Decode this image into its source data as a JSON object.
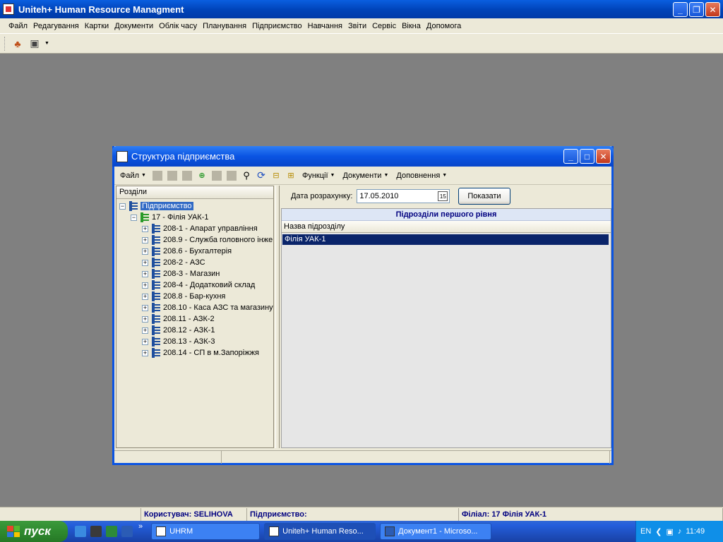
{
  "app": {
    "title": "Uniteh+ Human Resource Managment",
    "menu": [
      "Файл",
      "Редагування",
      "Картки",
      "Документи",
      "Облік часу",
      "Планування",
      "Підприємство",
      "Навчання",
      "Звіти",
      "Сервіс",
      "Вікна",
      "Допомога"
    ]
  },
  "child": {
    "title": "Структура підприємства",
    "toolbar": {
      "file": "Файл",
      "functions": "Функції",
      "documents": "Документи",
      "additions": "Доповнення"
    },
    "left_header": "Розділи",
    "tree": {
      "root": "Підприємство",
      "branch": "17 - Філія УАК-1",
      "children": [
        "208-1 - Апарат управління",
        "208.9 - Служба головного інже",
        "208.6 - Бухгалтерія",
        "208-2 - АЗС",
        "208-3 - Магазин",
        "208-4 - Додатковий склад",
        "208.8 - Бар-кухня",
        "208.10 - Каса АЗС та магазину",
        "208.11 - АЗК-2",
        "208.12 - АЗК-1",
        "208.13 - АЗК-3",
        "208.14 - СП в м.Запоріжжя"
      ]
    },
    "date_label": "Дата розрахунку:",
    "date_value": "17.05.2010",
    "calendar_day": "15",
    "show_button": "Показати",
    "grid": {
      "title": "Підрозділи першого рівня",
      "column": "Назва підрозділу",
      "rows": [
        "Філія УАК-1"
      ]
    }
  },
  "status": {
    "user": "Користувач: SELIHOVA",
    "company": "Підприємство:",
    "branch": "Філіал: 17 Філія УАК-1"
  },
  "taskbar": {
    "start": "пуск",
    "tasks": [
      "UHRM",
      "Uniteh+ Human Reso...",
      "Документ1 - Microso..."
    ],
    "lang": "EN",
    "clock": "11:49",
    "overflow": "»"
  },
  "colors": {
    "titlebar": "#0a54e3",
    "selection": "#0a246a",
    "status_text": "#000080"
  }
}
